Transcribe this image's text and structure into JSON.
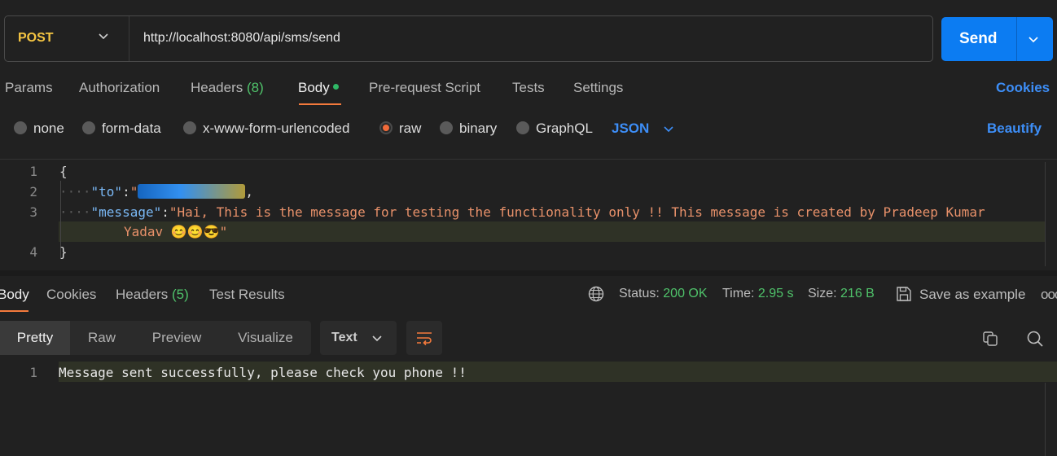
{
  "request": {
    "method": "POST",
    "url": "http://localhost:8080/api/sms/send",
    "send_label": "Send"
  },
  "request_tabs": {
    "params": "Params",
    "authorization": "Authorization",
    "headers": "Headers",
    "headers_count": "(8)",
    "body": "Body",
    "prerequest": "Pre-request Script",
    "tests": "Tests",
    "settings": "Settings",
    "cookies": "Cookies"
  },
  "body_types": {
    "none": "none",
    "form_data": "form-data",
    "urlencoded": "x-www-form-urlencoded",
    "raw": "raw",
    "binary": "binary",
    "graphql": "GraphQL",
    "selected": "raw",
    "language": "JSON",
    "beautify": "Beautify"
  },
  "editor": {
    "line_numbers": [
      "1",
      "2",
      "3",
      "4"
    ],
    "open_brace": "{",
    "close_brace": "}",
    "to_key": "\"to\"",
    "message_key": "\"message\"",
    "colon": ":",
    "comma": ",",
    "message_value_line1": "\"Hai, This is the message for testing the functionality only !! This message is created by Pradeep Kumar",
    "message_value_line2": "Yadav 😊😊😎\""
  },
  "response_tabs": {
    "body": "Body",
    "cookies": "Cookies",
    "headers": "Headers",
    "headers_count": "(5)",
    "test_results": "Test Results"
  },
  "response_meta": {
    "status_label": "Status:",
    "status_value": "200 OK",
    "time_label": "Time:",
    "time_value": "2.95 s",
    "size_label": "Size:",
    "size_value": "216 B",
    "save_example": "Save as example",
    "more": "ooo"
  },
  "view_modes": {
    "pretty": "Pretty",
    "raw": "Raw",
    "preview": "Preview",
    "visualize": "Visualize",
    "format": "Text"
  },
  "response_body": {
    "line_number": "1",
    "text": "Message sent successfully, please check you phone !!"
  },
  "colors": {
    "accent_orange": "#f47a3c",
    "send_blue": "#0c7cf2",
    "link_blue": "#3d8ef7",
    "success_green": "#4fc26a",
    "method_yellow": "#f5c542"
  }
}
